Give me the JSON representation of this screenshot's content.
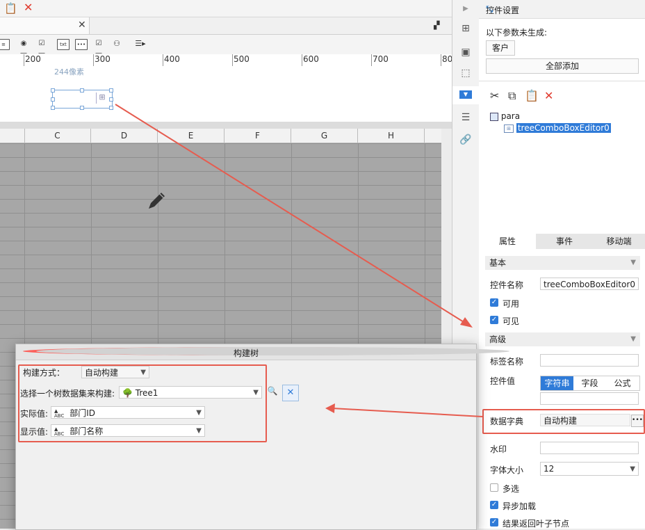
{
  "toolbar": {
    "ruler_ticks": [
      "200",
      "300",
      "400",
      "500",
      "600",
      "700",
      "80"
    ]
  },
  "param_area": {
    "width_label": "244像素"
  },
  "sheet": {
    "columns": [
      "C",
      "D",
      "E",
      "F",
      "G",
      "H"
    ]
  },
  "panel": {
    "title": "控件设置",
    "unset_text": "以下参数未生成:",
    "customer_button": "客户",
    "add_all_button": "全部添加",
    "tree": {
      "root": "para",
      "child": "treeComboBoxEditor0"
    },
    "tabs": [
      "属性",
      "事件",
      "移动端"
    ],
    "section_basic": "基本",
    "widget_name_label": "控件名称",
    "widget_name_value": "treeComboBoxEditor0",
    "enabled_label": "可用",
    "visible_label": "可见",
    "section_advanced": "高级",
    "tag_name_label": "标签名称",
    "widget_value_label": "控件值",
    "value_types": [
      "字符串",
      "字段",
      "公式"
    ],
    "dict_label": "数据字典",
    "dict_value": "自动构建",
    "watermark_label": "水印",
    "font_size_label": "字体大小",
    "font_size_value": "12",
    "multi_label": "多选",
    "async_label": "异步加载",
    "leaf_label": "结果返回叶子节点"
  },
  "dialog": {
    "title": "构建树",
    "build_mode_label": "构建方式：",
    "build_mode_value": "自动构建",
    "dataset_label": "选择一个树数据集来构建:",
    "dataset_value": "Tree1",
    "actual_label": "实际值:",
    "actual_value": "部门ID",
    "display_label": "显示值:",
    "display_value": "部门名称"
  }
}
